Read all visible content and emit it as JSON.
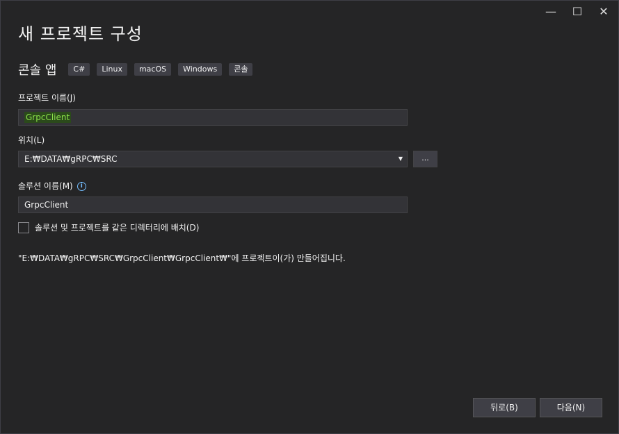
{
  "window": {
    "title": "새 프로젝트 구성",
    "controls": {
      "minimize": "—",
      "maximize": "☐",
      "close": "✕"
    }
  },
  "template": {
    "name": "콘솔 앱",
    "tags": [
      "C#",
      "Linux",
      "macOS",
      "Windows",
      "콘솔"
    ]
  },
  "project_name": {
    "label": "프로젝트 이름(J)",
    "value": "GrpcClient"
  },
  "location": {
    "label": "위치(L)",
    "value": "E:₩DATA₩gRPC₩SRC",
    "browse_label": "..."
  },
  "solution_name": {
    "label": "솔루션 이름(M)",
    "value": "GrpcClient",
    "info_icon": "i"
  },
  "same_dir": {
    "label": "솔루션 및 프로젝트를 같은 디렉터리에 배치(D)",
    "checked": false
  },
  "path_note": "\"E:₩DATA₩gRPC₩SRC₩GrpcClient₩GrpcClient₩\"에 프로젝트이(가) 만들어집니다.",
  "buttons": {
    "back": "뒤로(B)",
    "next": "다음(N)"
  }
}
